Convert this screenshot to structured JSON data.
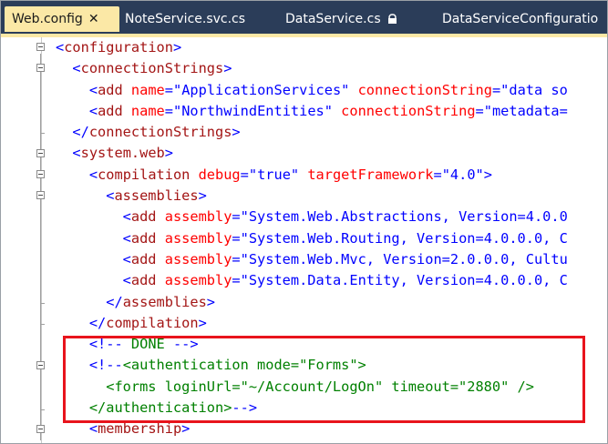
{
  "tabs": [
    {
      "label": "Web.config",
      "active": true,
      "close": "✕"
    },
    {
      "label": "NoteService.svc.cs"
    },
    {
      "label": "DataService.cs",
      "locked": true
    },
    {
      "label": "DataServiceConfiguratio"
    }
  ],
  "code": [
    [
      [
        "b",
        "<"
      ],
      [
        "t",
        "configuration"
      ],
      [
        "b",
        ">"
      ]
    ],
    [
      [
        "b",
        "  <"
      ],
      [
        "t",
        "connectionStrings"
      ],
      [
        "b",
        ">"
      ]
    ],
    [
      [
        "b",
        "    <"
      ],
      [
        "t",
        "add"
      ],
      [
        "a",
        " name"
      ],
      [
        "b",
        "=\""
      ],
      [
        "v",
        "ApplicationServices"
      ],
      [
        "b",
        "\""
      ],
      [
        "a",
        " connectionString"
      ],
      [
        "b",
        "=\""
      ],
      [
        "v",
        "data so"
      ]
    ],
    [
      [
        "b",
        "    <"
      ],
      [
        "t",
        "add"
      ],
      [
        "a",
        " name"
      ],
      [
        "b",
        "=\""
      ],
      [
        "v",
        "NorthwindEntities"
      ],
      [
        "b",
        "\""
      ],
      [
        "a",
        " connectionString"
      ],
      [
        "b",
        "=\""
      ],
      [
        "v",
        "metadata="
      ]
    ],
    [
      [
        "b",
        "  </"
      ],
      [
        "t",
        "connectionStrings"
      ],
      [
        "b",
        ">"
      ]
    ],
    [
      [
        "b",
        "  <"
      ],
      [
        "t",
        "system.web"
      ],
      [
        "b",
        ">"
      ]
    ],
    [
      [
        "b",
        "    <"
      ],
      [
        "t",
        "compilation"
      ],
      [
        "a",
        " debug"
      ],
      [
        "b",
        "=\""
      ],
      [
        "v",
        "true"
      ],
      [
        "b",
        "\""
      ],
      [
        "a",
        " targetFramework"
      ],
      [
        "b",
        "=\""
      ],
      [
        "v",
        "4.0"
      ],
      [
        "b",
        "\">"
      ]
    ],
    [
      [
        "b",
        "      <"
      ],
      [
        "t",
        "assemblies"
      ],
      [
        "b",
        ">"
      ]
    ],
    [
      [
        "b",
        "        <"
      ],
      [
        "t",
        "add"
      ],
      [
        "a",
        " assembly"
      ],
      [
        "b",
        "=\""
      ],
      [
        "v",
        "System.Web.Abstractions, Version=4.0.0"
      ]
    ],
    [
      [
        "b",
        "        <"
      ],
      [
        "t",
        "add"
      ],
      [
        "a",
        " assembly"
      ],
      [
        "b",
        "=\""
      ],
      [
        "v",
        "System.Web.Routing, Version=4.0.0.0, C"
      ]
    ],
    [
      [
        "b",
        "        <"
      ],
      [
        "t",
        "add"
      ],
      [
        "a",
        " assembly"
      ],
      [
        "b",
        "=\""
      ],
      [
        "v",
        "System.Web.Mvc, Version=2.0.0.0, Cultu"
      ]
    ],
    [
      [
        "b",
        "        <"
      ],
      [
        "t",
        "add"
      ],
      [
        "a",
        " assembly"
      ],
      [
        "b",
        "=\""
      ],
      [
        "v",
        "System.Data.Entity, Version=4.0.0.0, C"
      ]
    ],
    [
      [
        "b",
        "      </"
      ],
      [
        "t",
        "assemblies"
      ],
      [
        "b",
        ">"
      ]
    ],
    [
      [
        "b",
        "    </"
      ],
      [
        "t",
        "compilation"
      ],
      [
        "b",
        ">"
      ]
    ],
    [
      [
        "b",
        "    <!--"
      ],
      [
        "c",
        " DONE "
      ],
      [
        "b",
        "-->"
      ]
    ],
    [
      [
        "b",
        "    <!--"
      ],
      [
        "c",
        "<authentication mode=\"Forms\">"
      ]
    ],
    [
      [
        "c",
        "      <forms loginUrl=\"~/Account/LogOn\" timeout=\"2880\" />"
      ]
    ],
    [
      [
        "c",
        "    </authentication>"
      ],
      [
        "b",
        "-->"
      ]
    ],
    [
      [
        "b",
        "    <"
      ],
      [
        "t",
        "membership"
      ],
      [
        "b",
        ">"
      ]
    ]
  ]
}
